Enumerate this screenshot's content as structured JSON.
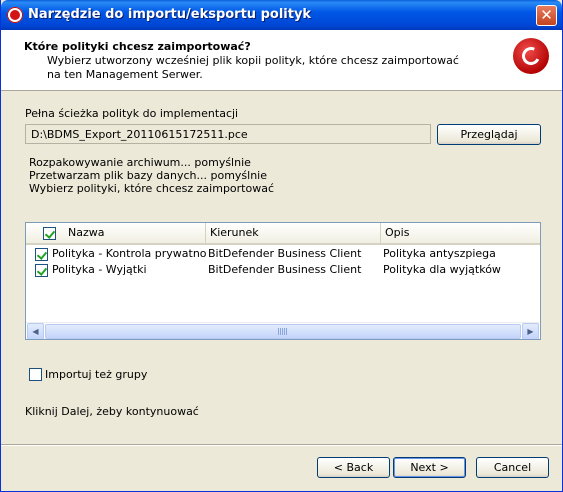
{
  "window": {
    "title": "Narzędzie do importu/eksportu polityk",
    "close_symbol": "✕"
  },
  "header": {
    "title": "Które polityki chcesz zaimportować?",
    "description": "Wybierz utworzony wcześniej plik kopii polityk, które chcesz zaimportować na ten Management Serwer.",
    "logo_icon": "bitdefender-logo-icon"
  },
  "path": {
    "label": "Pełna ścieżka polityk do implementacji",
    "value": "D:\\BDMS_Export_20110615172511.pce",
    "browse_label": "Przeglądaj"
  },
  "status_lines": [
    "Rozpakowywanie archiwum... pomyślnie",
    "Przetwarzam plik bazy danych... pomyślnie",
    "Wybierz polityki, które chcesz zaimportować"
  ],
  "table": {
    "columns": [
      "Nazwa",
      "Kierunek",
      "Opis"
    ],
    "header_checked": true,
    "rows": [
      {
        "checked": true,
        "name": "Polityka - Kontrola prywatności",
        "direction": "BitDefender Business Client",
        "description": "Polityka antyszpiega"
      },
      {
        "checked": true,
        "name": "Polityka - Wyjątki",
        "direction": "BitDefender Business Client",
        "description": "Polityka dla wyjątków"
      }
    ]
  },
  "import_groups": {
    "label": "Importuj też grupy",
    "checked": false
  },
  "hint": "Kliknij Dalej, żeby kontynuować",
  "buttons": {
    "back": "< Back",
    "next": "Next >",
    "cancel": "Cancel"
  }
}
